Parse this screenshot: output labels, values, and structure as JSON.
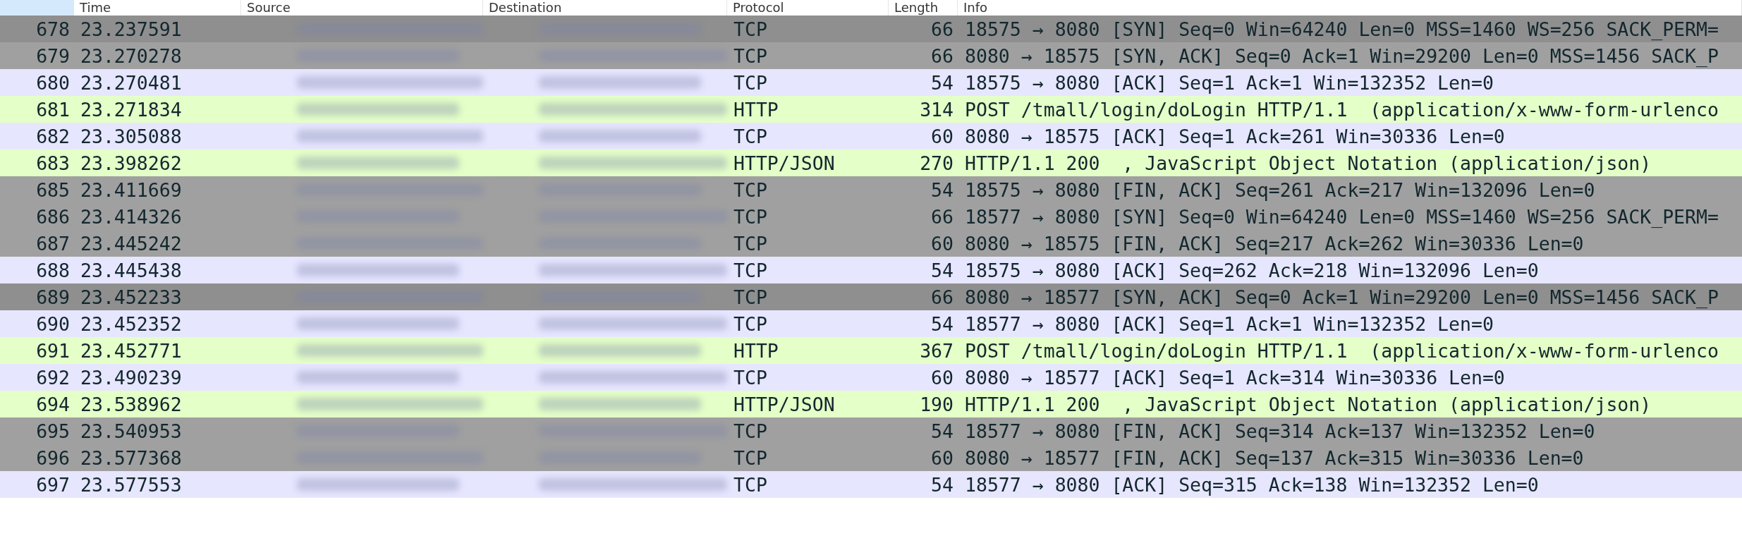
{
  "columns": [
    {
      "sorted": true
    },
    {
      "label": "Time",
      "sorted": false
    },
    {
      "label": "Source",
      "sorted": false,
      "redacted": true
    },
    {
      "label": "Destination",
      "sorted": false,
      "redacted": true
    },
    {
      "label": "Protocol",
      "sorted": false
    },
    {
      "label": "Length",
      "sorted": false
    },
    {
      "label": "Info",
      "sorted": false
    }
  ],
  "rows": [
    {
      "no": "678",
      "time": "23.237591",
      "protocol": "TCP",
      "length": "66",
      "info": "18575 → 8080 [SYN] Seq=0 Win=64240 Len=0 MSS=1460 WS=256 SACK_PERM=",
      "color": "#8f8f8f"
    },
    {
      "no": "679",
      "time": "23.270278",
      "protocol": "TCP",
      "length": "66",
      "info": "8080 → 18575 [SYN, ACK] Seq=0 Ack=1 Win=29200 Len=0 MSS=1456 SACK_P",
      "color": "#a0a0a0"
    },
    {
      "no": "680",
      "time": "23.270481",
      "protocol": "TCP",
      "length": "54",
      "info": "18575 → 8080 [ACK] Seq=1 Ack=1 Win=132352 Len=0",
      "color": "#e7e6ff"
    },
    {
      "no": "681",
      "time": "23.271834",
      "protocol": "HTTP",
      "length": "314",
      "info": "POST /tmall/login/doLogin HTTP/1.1  (application/x-www-form-urlenco",
      "color": "#e4ffc7"
    },
    {
      "no": "682",
      "time": "23.305088",
      "protocol": "TCP",
      "length": "60",
      "info": "8080 → 18575 [ACK] Seq=1 Ack=261 Win=30336 Len=0",
      "color": "#e7e6ff"
    },
    {
      "no": "683",
      "time": "23.398262",
      "protocol": "HTTP/JSON",
      "length": "270",
      "info": "HTTP/1.1 200  , JavaScript Object Notation (application/json)",
      "color": "#e4ffc7"
    },
    {
      "no": "685",
      "time": "23.411669",
      "protocol": "TCP",
      "length": "54",
      "info": "18575 → 8080 [FIN, ACK] Seq=261 Ack=217 Win=132096 Len=0",
      "color": "#a0a0a0"
    },
    {
      "no": "686",
      "time": "23.414326",
      "protocol": "TCP",
      "length": "66",
      "info": "18577 → 8080 [SYN] Seq=0 Win=64240 Len=0 MSS=1460 WS=256 SACK_PERM=",
      "color": "#a0a0a0"
    },
    {
      "no": "687",
      "time": "23.445242",
      "protocol": "TCP",
      "length": "60",
      "info": "8080 → 18575 [FIN, ACK] Seq=217 Ack=262 Win=30336 Len=0",
      "color": "#a0a0a0"
    },
    {
      "no": "688",
      "time": "23.445438",
      "protocol": "TCP",
      "length": "54",
      "info": "18575 → 8080 [ACK] Seq=262 Ack=218 Win=132096 Len=0",
      "color": "#e7e6ff"
    },
    {
      "no": "689",
      "time": "23.452233",
      "protocol": "TCP",
      "length": "66",
      "info": "8080 → 18577 [SYN, ACK] Seq=0 Ack=1 Win=29200 Len=0 MSS=1456 SACK_P",
      "color": "#8f8f8f"
    },
    {
      "no": "690",
      "time": "23.452352",
      "protocol": "TCP",
      "length": "54",
      "info": "18577 → 8080 [ACK] Seq=1 Ack=1 Win=132352 Len=0",
      "color": "#e7e6ff"
    },
    {
      "no": "691",
      "time": "23.452771",
      "protocol": "HTTP",
      "length": "367",
      "info": "POST /tmall/login/doLogin HTTP/1.1  (application/x-www-form-urlenco",
      "color": "#e4ffc7"
    },
    {
      "no": "692",
      "time": "23.490239",
      "protocol": "TCP",
      "length": "60",
      "info": "8080 → 18577 [ACK] Seq=1 Ack=314 Win=30336 Len=0",
      "color": "#e7e6ff"
    },
    {
      "no": "694",
      "time": "23.538962",
      "protocol": "HTTP/JSON",
      "length": "190",
      "info": "HTTP/1.1 200  , JavaScript Object Notation (application/json)",
      "color": "#e4ffc7"
    },
    {
      "no": "695",
      "time": "23.540953",
      "protocol": "TCP",
      "length": "54",
      "info": "18577 → 8080 [FIN, ACK] Seq=314 Ack=137 Win=132352 Len=0",
      "color": "#a0a0a0"
    },
    {
      "no": "696",
      "time": "23.577368",
      "protocol": "TCP",
      "length": "60",
      "info": "8080 → 18577 [FIN, ACK] Seq=137 Ack=315 Win=30336 Len=0",
      "color": "#a0a0a0"
    },
    {
      "no": "697",
      "time": "23.577553",
      "protocol": "TCP",
      "length": "54",
      "info": "18577 → 8080 [ACK] Seq=315 Ack=138 Win=132352 Len=0",
      "color": "#e7e6ff"
    }
  ]
}
